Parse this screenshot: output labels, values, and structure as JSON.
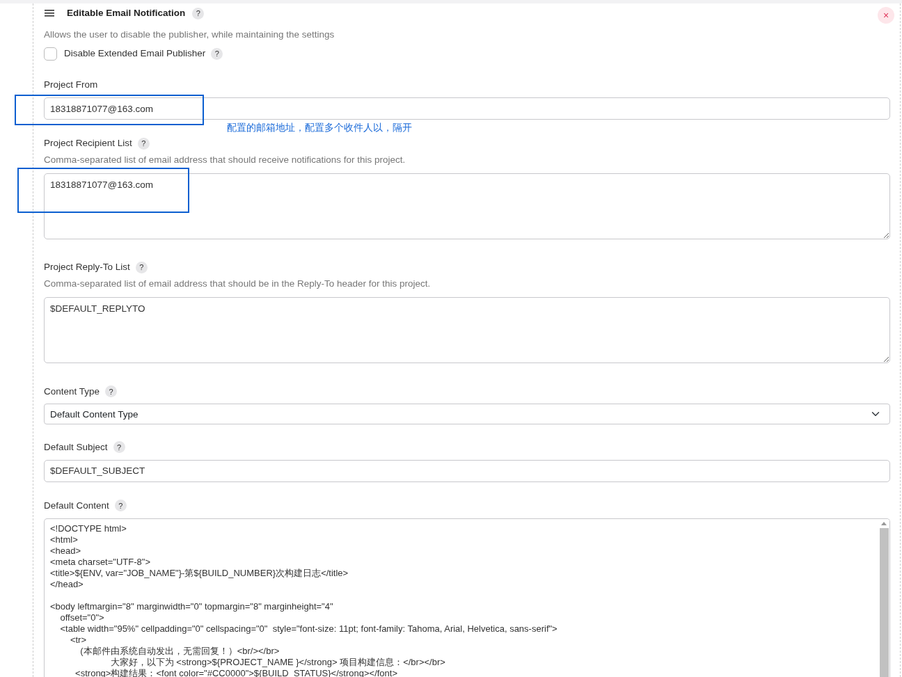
{
  "section": {
    "title": "Editable Email Notification",
    "help": "?",
    "close": "×"
  },
  "disable": {
    "description": "Allows the user to disable the publisher, while maintaining the settings",
    "label": "Disable Extended Email Publisher",
    "help": "?",
    "checked": false
  },
  "fields": [
    {
      "kind": "input",
      "label": "Project From",
      "value": "18318871077@163.com"
    },
    {
      "kind": "textarea",
      "label": "Project Recipient List",
      "help": "?",
      "description": "Comma-separated list of email address that should receive notifications for this project.",
      "value": "18318871077@163.com"
    },
    {
      "kind": "textarea",
      "label": "Project Reply-To List",
      "help": "?",
      "description": "Comma-separated list of email address that should be in the Reply-To header for this project.",
      "value": "$DEFAULT_REPLYTO"
    },
    {
      "kind": "select",
      "label": "Content Type",
      "help": "?",
      "value": "Default Content Type"
    },
    {
      "kind": "input",
      "label": "Default Subject",
      "help": "?",
      "value": "$DEFAULT_SUBJECT"
    },
    {
      "kind": "code",
      "label": "Default Content",
      "help": "?",
      "blocks": [
        [
          "<!DOCTYPE html>",
          "<html>",
          "<head>",
          "<meta charset=\"UTF-8\">",
          "<title>${ENV, var=\"JOB_NAME\"}-第${BUILD_NUMBER}次构建日志</title>",
          "</head>"
        ],
        [
          "<body leftmargin=\"8\" marginwidth=\"0\" topmargin=\"8\" marginheight=\"4\"",
          "    offset=\"0\">",
          "    <table width=\"95%\" cellpadding=\"0\" cellspacing=\"0\"  style=\"font-size: 11pt; font-family: Tahoma, Arial, Helvetica, sans-serif\">",
          "        <tr>",
          "            (本邮件由系统自动发出，无需回复！）<br/></br>",
          "                        大家好，以下为 <strong>${PROJECT_NAME }</strong> 项目构建信息：</br></br>",
          "          <strong>构建结果：<font color=\"#CC0000\">${BUILD_STATUS}</strong></font>"
        ]
      ]
    }
  ],
  "annotation": {
    "note": "配置的邮箱地址，配置多个收件人以，隔开"
  }
}
